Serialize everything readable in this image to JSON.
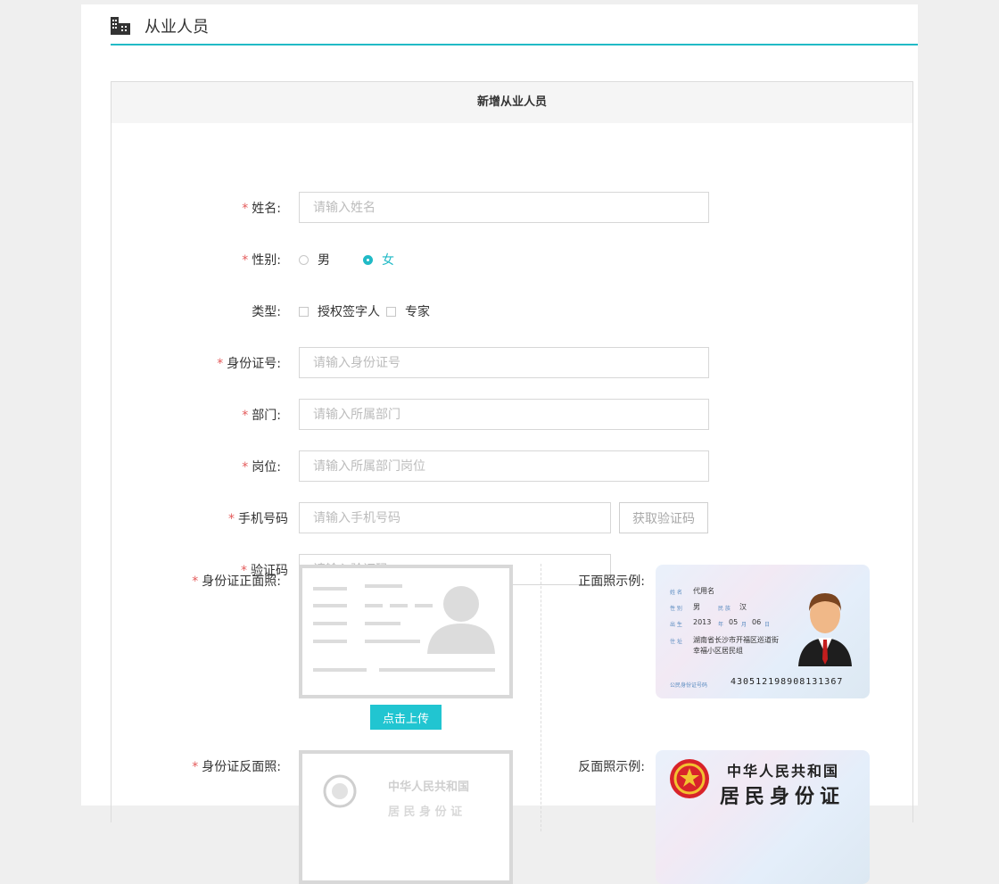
{
  "header": {
    "title": "从业人员",
    "icon": "building-icon"
  },
  "form": {
    "title": "新增从业人员",
    "required_mark": "*",
    "name": {
      "label": "姓名:",
      "placeholder": "请输入姓名"
    },
    "gender": {
      "label": "性别:",
      "options": [
        "男",
        "女"
      ],
      "selected": "女"
    },
    "type": {
      "label": "类型:",
      "options": [
        "授权签字人",
        "专家"
      ]
    },
    "id_number": {
      "label": "身份证号:",
      "placeholder": "请输入身份证号"
    },
    "department": {
      "label": "部门:",
      "placeholder": "请输入所属部门"
    },
    "position": {
      "label": "岗位:",
      "placeholder": "请输入所属部门岗位"
    },
    "phone": {
      "label": "手机号码",
      "placeholder": "请输入手机号码",
      "code_button": "获取验证码"
    },
    "code": {
      "label": "验证码",
      "placeholder": "请输入验证码"
    },
    "id_front": {
      "label": "身份证正面照:",
      "upload_button": "点击上传",
      "sample_label": "正面照示例:"
    },
    "id_back": {
      "label": "身份证反面照:",
      "sample_label": "反面照示例:"
    }
  },
  "sample_front": {
    "name_key": "姓 名",
    "name": "代用名",
    "gender_key": "性 别",
    "gender": "男",
    "ethnic_key": "民 族",
    "ethnic": "汉",
    "birth_key": "出 生",
    "birth_year": "2013",
    "year_unit": "年",
    "birth_month": "05",
    "month_unit": "月",
    "birth_day": "06",
    "day_unit": "日",
    "address_key": "住 址",
    "address_line1": "湖南省长沙市开福区巡道街",
    "address_line2": "幸福小区居民组",
    "number_key": "公民身份证号码",
    "number": "430512198908131367"
  },
  "sample_back": {
    "country": "中华人民共和国",
    "card_title": "居民身份证"
  },
  "placeholder_back": {
    "country": "中华人民共和国",
    "card_title": "居 民 身 份 证"
  },
  "colors": {
    "accent": "#21bac6",
    "upload_button": "#21c5d1",
    "required": "#e45a5a"
  }
}
